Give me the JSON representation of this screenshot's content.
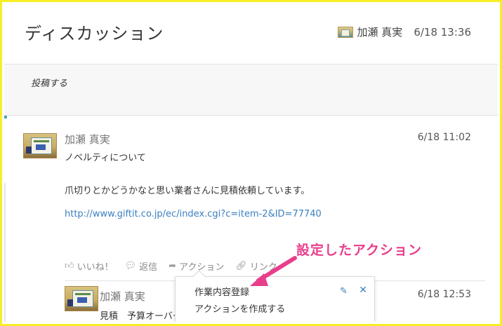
{
  "header": {
    "title": "ディスカッション",
    "user_name": "加瀬 真実",
    "timestamp": "6/18 13:36"
  },
  "post": {
    "placeholder": "投稿する"
  },
  "comments": [
    {
      "author": "加瀬 真実",
      "time": "6/18 11:02",
      "lines": [
        "ノベルティについて",
        "爪切りとかどうかなと思い業者さんに見積依頼しています。"
      ],
      "link": "http://www.giftit.co.jp/ec/index.cgi?c=item-2&ID=77740",
      "actions": {
        "like": "いいね！",
        "reply": "返信",
        "action": "アクション",
        "link": "リンク"
      }
    },
    {
      "author": "加瀬 真実",
      "time": "6/18 12:53",
      "text": "見積　予算オーバー"
    }
  ],
  "action_menu": {
    "items": [
      "作業内容登録",
      "アクションを作成する"
    ]
  },
  "annotation": {
    "text": "設定したアクション",
    "color": "#e83e8c"
  },
  "colors": {
    "frame": "#f7ee2a",
    "link": "#3a7fc1",
    "accent": "#4aa6b5"
  }
}
